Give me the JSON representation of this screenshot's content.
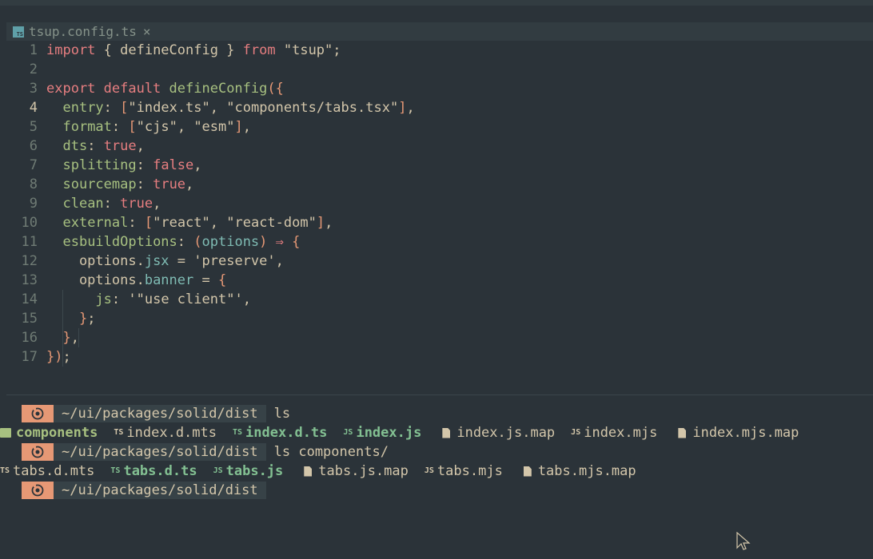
{
  "tab": {
    "icon": "TS",
    "filename": "tsup.config.ts",
    "close": "×"
  },
  "editor": {
    "active_line": 4,
    "lines": [
      "1",
      "2",
      "3",
      "4",
      "5",
      "6",
      "7",
      "8",
      "9",
      "10",
      "11",
      "12",
      "13",
      "14",
      "15",
      "16",
      "17"
    ]
  },
  "terminal": {
    "prompt_path": "~/ui/packages/solid/dist",
    "cmd1": "ls",
    "list1": [
      "components",
      "index.d.mts",
      "index.d.ts",
      "index.js",
      "index.js.map",
      "index.mjs",
      "index.mjs.map"
    ],
    "cmd2": "ls components/",
    "list2": [
      "tabs.d.mts",
      "tabs.d.ts",
      "tabs.js",
      "tabs.js.map",
      "tabs.mjs",
      "tabs.mjs.map"
    ],
    "icons": {
      "ts": "TS",
      "js": "JS"
    }
  },
  "colors": {
    "background": "#2b3339",
    "prompt_icon": "#e69875",
    "green": "#a7c080",
    "aqua": "#83c092",
    "red": "#e67e80"
  }
}
